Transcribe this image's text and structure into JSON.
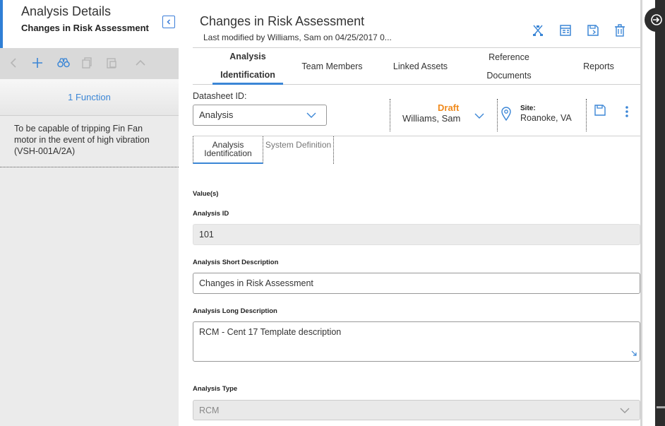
{
  "left_panel": {
    "title": "Analysis Details",
    "subtitle": "Changes in Risk Assessment",
    "function_header": "1 Function",
    "function_item": "To be capable of tripping Fin Fan motor in the event of high vibration (VSH-001A/2A)"
  },
  "main": {
    "title": "Changes in Risk Assessment",
    "modified": "Last modified by Williams, Sam on 04/25/2017 0...",
    "tabs": [
      {
        "label": "Analysis Identification",
        "active": true
      },
      {
        "label": "Team Members",
        "active": false
      },
      {
        "label": "Linked Assets",
        "active": false
      },
      {
        "label": "Reference Documents",
        "active": false
      },
      {
        "label": "Reports",
        "active": false
      }
    ],
    "datasheet_label": "Datasheet ID:",
    "datasheet_value": "Analysis",
    "state": {
      "status": "Draft",
      "owner": "Williams, Sam"
    },
    "site": {
      "label": "Site:",
      "value": "Roanoke, VA"
    },
    "subtabs": [
      {
        "label": "Analysis Identification",
        "active": true
      },
      {
        "label": "System Definition",
        "active": false
      }
    ],
    "values_label": "Value(s)",
    "fields": {
      "analysis_id": {
        "label": "Analysis ID",
        "value": "101"
      },
      "short_desc": {
        "label": "Analysis Short Description",
        "value": "Changes in Risk Assessment"
      },
      "long_desc": {
        "label": "Analysis Long Description",
        "value": "RCM - Cent 17 Template description"
      },
      "analysis_type": {
        "label": "Analysis Type",
        "value": "RCM"
      }
    }
  },
  "colors": {
    "accent": "#3b86d6",
    "draft": "#f08a1c",
    "panel_bg": "#ebebeb"
  },
  "icons": [
    "collapse-left-icon",
    "back-icon",
    "add-icon",
    "binoculars-icon",
    "copy-icon",
    "paste-icon",
    "collapse-up-icon",
    "tree-icon",
    "report-icon",
    "save-icon",
    "delete-icon",
    "location-pin-icon",
    "more-vertical-icon",
    "enter-icon"
  ]
}
